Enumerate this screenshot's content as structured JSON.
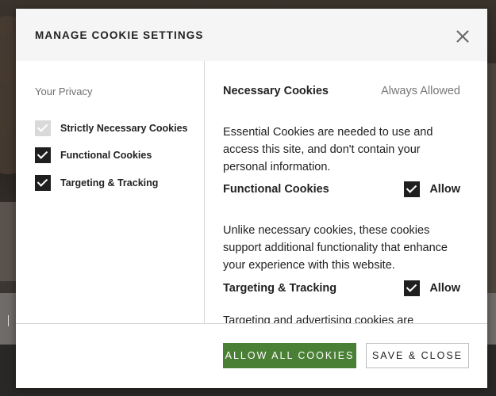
{
  "modal": {
    "title": "MANAGE COOKIE SETTINGS",
    "close_icon": "close-icon"
  },
  "sidebar": {
    "heading": "Your Privacy",
    "items": [
      {
        "label": "Strictly Necessary Cookies",
        "checked": true,
        "disabled": true
      },
      {
        "label": "Functional Cookies",
        "checked": true,
        "disabled": false
      },
      {
        "label": "Targeting & Tracking",
        "checked": true,
        "disabled": false
      }
    ]
  },
  "content": {
    "sections": [
      {
        "title": "Necessary Cookies",
        "status": "Always Allowed",
        "description": "Essential Cookies are needed to use and access this site, and don't contain your personal information."
      },
      {
        "title": "Functional Cookies",
        "allow_label": "Allow",
        "checked": true,
        "description": "Unlike necessary cookies, these cookies support additional functionality that enhance your experience with this website."
      },
      {
        "title": "Targeting & Tracking",
        "allow_label": "Allow",
        "checked": true,
        "description": "Targeting and advertising cookies are"
      }
    ]
  },
  "footer": {
    "allow_all_label": "ALLOW ALL COOKIES",
    "save_close_label": "SAVE & CLOSE"
  },
  "colors": {
    "accent_green": "#4a7f36",
    "checkbox_on": "#1f1f1f",
    "checkbox_disabled": "#d9d9d9"
  }
}
